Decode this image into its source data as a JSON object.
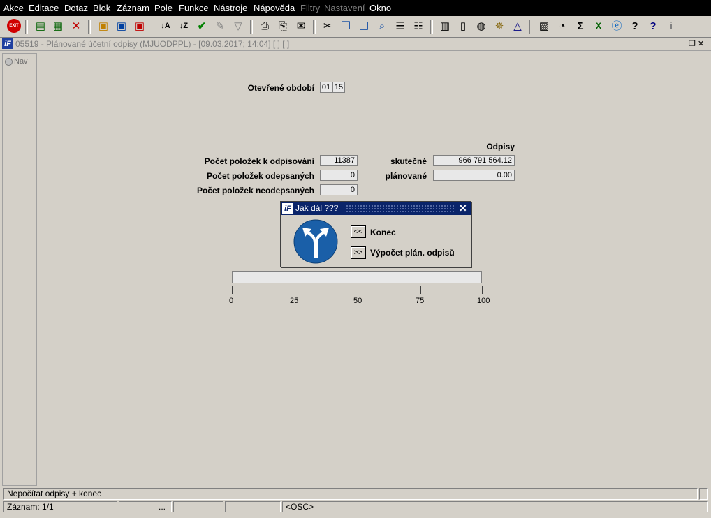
{
  "menu": [
    "Akce",
    "Editace",
    "Dotaz",
    "Blok",
    "Záznam",
    "Pole",
    "Funkce",
    "Nástroje",
    "Nápověda",
    "Filtry",
    "Nastavení",
    "Okno"
  ],
  "toolbar": {
    "exit_label": "EXIT",
    "icons": [
      "insert-record-icon",
      "duplicate-record-icon",
      "delete-record-icon",
      "query-icon",
      "execute-query-icon",
      "cancel-query-icon",
      "sort-asc-icon",
      "sort-desc-icon",
      "commit-check-icon",
      "tools-icon",
      "filter-icon",
      "print-icon",
      "print-preview-icon",
      "mail-icon",
      "cut-icon",
      "copy-icon",
      "paste-icon",
      "find-icon",
      "list-icon",
      "tree-icon",
      "clipboard-icon",
      "document-icon",
      "globe-icon",
      "ship-wheel-icon",
      "triangle-eye-icon",
      "report-icon",
      "dial-icon",
      "sum-icon",
      "excel-icon",
      "internet-icon",
      "context-help-icon",
      "help-icon",
      "info-icon"
    ]
  },
  "window": {
    "title": "05519 - Plánované účetní odpisy (MJUODPPL) - [09.03.2017; 14:04]  [ ]  [ ]",
    "nav_label": "Nav"
  },
  "form": {
    "period_label": "Otevřené období",
    "period_month": "01",
    "period_year": "15",
    "odpisy_header": "Odpisy",
    "count_to_write_off_label": "Počet položek k odpisování",
    "count_to_write_off": "11387",
    "count_written_off_label": "Počet položek odepsaných",
    "count_written_off": "0",
    "count_not_written_off_label": "Počet položek neodepsaných",
    "count_not_written_off": "0",
    "actual_label": "skutečné",
    "actual_value": "966 791 564.12",
    "planned_label": "plánované",
    "planned_value": "0.00"
  },
  "dialog": {
    "title": "Jak dál ???",
    "back_button": "<<",
    "back_label": "Konec",
    "forward_button": ">>",
    "forward_label": "Výpočet plán. odpisů"
  },
  "progress": {
    "value": 0,
    "ticks": [
      "0",
      "25",
      "50",
      "75",
      "100"
    ]
  },
  "status": {
    "hint": "Nepočítat odpisy + konec",
    "record": "Záznam: 1/1",
    "ellipsis": "...",
    "mode": "<OSC>"
  },
  "colors": {
    "titlebar_active": "#0a246a",
    "background": "#d4d0c8",
    "sign_blue": "#1a5fa8"
  }
}
